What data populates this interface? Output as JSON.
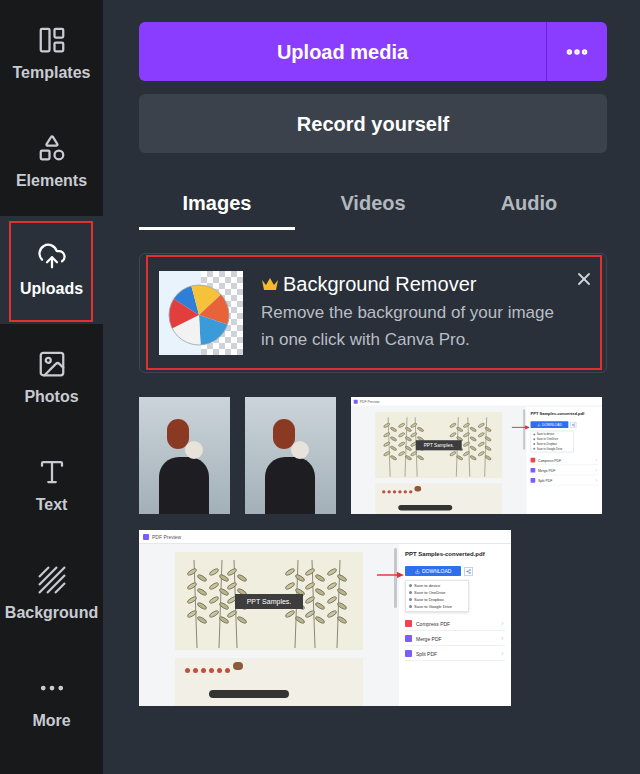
{
  "sidebar": {
    "items": [
      {
        "label": "Templates",
        "selected": false,
        "highlighted": false
      },
      {
        "label": "Elements",
        "selected": false,
        "highlighted": false
      },
      {
        "label": "Uploads",
        "selected": true,
        "highlighted": true
      },
      {
        "label": "Photos",
        "selected": false,
        "highlighted": false
      },
      {
        "label": "Text",
        "selected": false,
        "highlighted": false
      },
      {
        "label": "Background",
        "selected": false,
        "highlighted": false
      },
      {
        "label": "More",
        "selected": false,
        "highlighted": false
      }
    ]
  },
  "upload_button": {
    "label": "Upload media"
  },
  "record_button": {
    "label": "Record yourself"
  },
  "tabs": [
    {
      "label": "Images",
      "selected": true
    },
    {
      "label": "Videos",
      "selected": false
    },
    {
      "label": "Audio",
      "selected": false
    }
  ],
  "promo_card": {
    "title": "Background Remover",
    "description": "Remove the background of your image in one click with Canva Pro.",
    "highlighted": true
  },
  "thumbnails": [
    {
      "kind": "photo"
    },
    {
      "kind": "photo"
    },
    {
      "kind": "document",
      "app_title": "PDF Preview",
      "file_name": "PPT Samples-converted.pdf",
      "slide_label": "PPT Samples.",
      "download": "DOWNLOAD",
      "save_options": [
        "Save to device",
        "Save to OneDrive",
        "Save to Dropbox",
        "Save to Google Drive"
      ],
      "tools": [
        {
          "label": "Compress PDF",
          "color": "#e5484d"
        },
        {
          "label": "Merge PDF",
          "color": "#7c5cff"
        },
        {
          "label": "Split PDF",
          "color": "#7c5cff"
        }
      ]
    },
    {
      "kind": "document",
      "app_title": "PDF Preview",
      "file_name": "PPT Samples-converted.pdf",
      "slide_label": "PPT Samples.",
      "download": "DOWNLOAD",
      "save_options": [
        "Save to device",
        "Save to OneDrive",
        "Save to Dropbox",
        "Save to Google Drive"
      ],
      "tools": [
        {
          "label": "Compress PDF",
          "color": "#e5484d"
        },
        {
          "label": "Merge PDF",
          "color": "#7c5cff"
        },
        {
          "label": "Split PDF",
          "color": "#7c5cff"
        }
      ]
    }
  ]
}
